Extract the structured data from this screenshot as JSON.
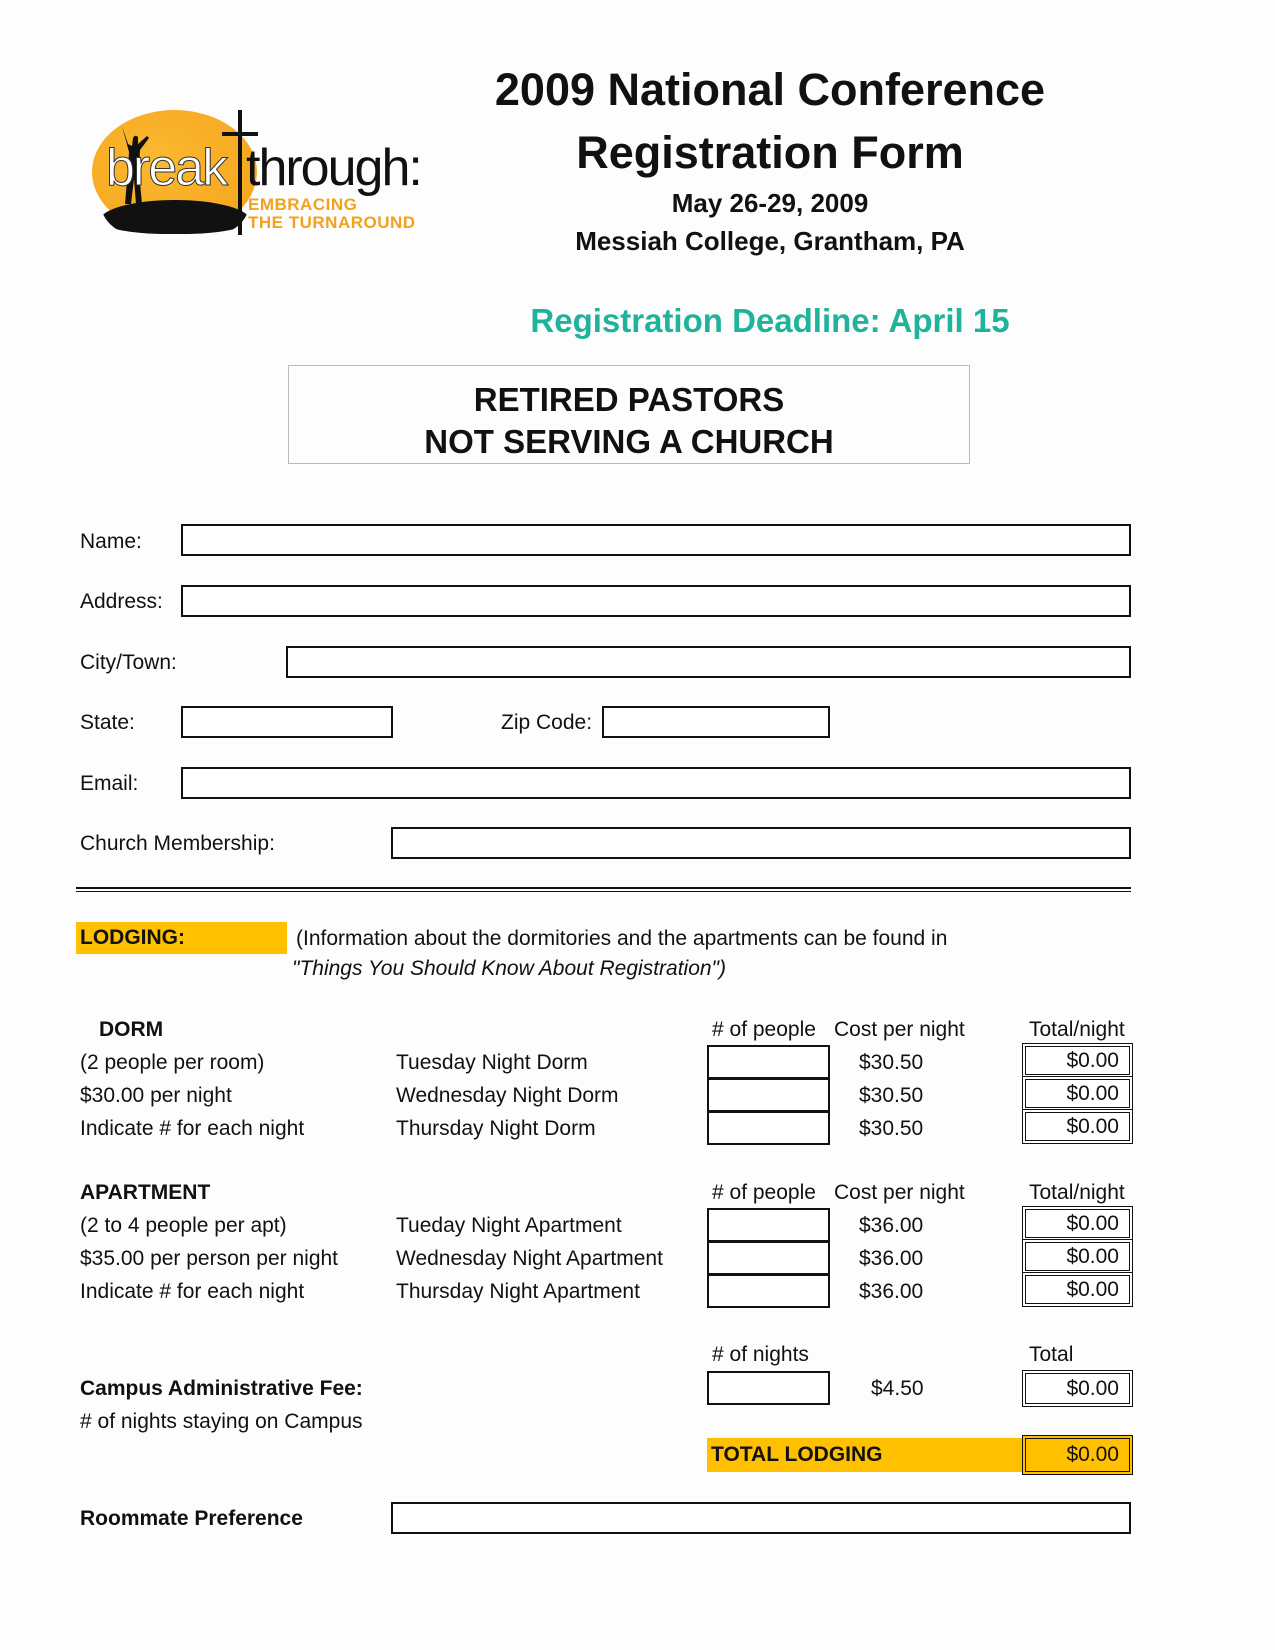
{
  "logo": {
    "word1": "break",
    "word2": "through:",
    "tagline_line1": "EMBRACING",
    "tagline_line2": "THE TURNAROUND"
  },
  "header": {
    "title_line1": "2009 National Conference",
    "title_line2": "Registration Form",
    "dates": "May 26-29, 2009",
    "location": "Messiah College, Grantham, PA",
    "deadline": "Registration Deadline:  April 15",
    "deadline_color": "#1fb39b"
  },
  "category_box": {
    "line1": "RETIRED PASTORS",
    "line2": "NOT SERVING A CHURCH"
  },
  "contact": {
    "name_label": "Name:",
    "name_value": "",
    "address_label": "Address:",
    "address_value": "",
    "city_label": "City/Town:",
    "city_value": "",
    "state_label": "State:",
    "state_value": "",
    "zip_label": "Zip Code:",
    "zip_value": "",
    "email_label": "Email:",
    "email_value": "",
    "church_label": "Church Membership:",
    "church_value": ""
  },
  "lodging": {
    "label": "LODGING:",
    "highlight_color": "#ffc000",
    "info_line1": "(Information about the dormitories and the apartments can be found in",
    "info_line2": "\"Things You Should Know About Registration\")",
    "dorm": {
      "heading": "DORM",
      "desc": [
        "(2 people per room)",
        "$30.00 per night",
        "Indicate # for each night"
      ],
      "col_people": "# of people",
      "col_cost": "Cost per night",
      "col_total": "Total/night",
      "rows": [
        {
          "label": "Tuesday Night Dorm",
          "people": "",
          "cost": "$30.50",
          "total": "$0.00"
        },
        {
          "label": "Wednesday Night Dorm",
          "people": "",
          "cost": "$30.50",
          "total": "$0.00"
        },
        {
          "label": "Thursday Night Dorm",
          "people": "",
          "cost": "$30.50",
          "total": "$0.00"
        }
      ]
    },
    "apartment": {
      "heading": "APARTMENT",
      "desc": [
        "(2 to 4 people per apt)",
        "$35.00 per person per night",
        "Indicate # for each night"
      ],
      "col_people": "# of people",
      "col_cost": "Cost per night",
      "col_total": "Total/night",
      "rows": [
        {
          "label": "Tueday Night Apartment",
          "people": "",
          "cost": "$36.00",
          "total": "$0.00"
        },
        {
          "label": "Wednesday Night Apartment",
          "people": "",
          "cost": "$36.00",
          "total": "$0.00"
        },
        {
          "label": "Thursday Night Apartment",
          "people": "",
          "cost": "$36.00",
          "total": "$0.00"
        }
      ]
    },
    "admin_fee": {
      "heading": "Campus Administrative Fee:",
      "desc": "# of nights staying on Campus",
      "col_nights": "# of nights",
      "nights": "",
      "rate": "$4.50",
      "col_total": "Total",
      "total": "$0.00"
    },
    "total_label": "TOTAL LODGING",
    "total_value": "$0.00"
  },
  "roommate": {
    "label": "Roommate Preference",
    "value": ""
  }
}
